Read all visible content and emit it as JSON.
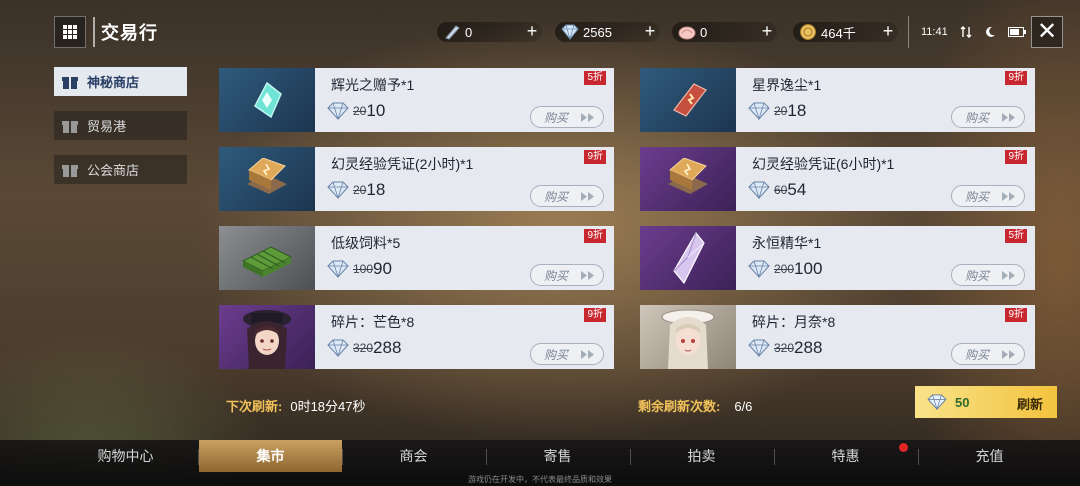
{
  "header": {
    "title": "交易行",
    "menu_icon": "grid-menu-icon",
    "currencies": [
      {
        "icon": "crystal-pen-icon",
        "value": "0"
      },
      {
        "icon": "diamond-icon",
        "value": "2565"
      },
      {
        "icon": "shell-icon",
        "value": "0"
      },
      {
        "icon": "gold-coin-icon",
        "value": "464千"
      }
    ],
    "time": "11:41"
  },
  "sidebar": {
    "items": [
      {
        "label": "神秘商店",
        "active": true
      },
      {
        "label": "贸易港",
        "active": false
      },
      {
        "label": "公会商店",
        "active": false
      }
    ]
  },
  "shop": {
    "buy_label": "购买",
    "items": [
      {
        "name": "辉光之赠予*1",
        "old_price": "20",
        "price": "10",
        "discount": "5折",
        "thumb": "glow-gift-icon"
      },
      {
        "name": "星界逸尘*1",
        "old_price": "20",
        "price": "18",
        "discount": "9折",
        "thumb": "star-dust-book-icon"
      },
      {
        "name": "幻灵经验凭证(2小时)*1",
        "old_price": "20",
        "price": "18",
        "discount": "9折",
        "thumb": "exp-book-icon"
      },
      {
        "name": "幻灵经验凭证(6小时)*1",
        "old_price": "60",
        "price": "54",
        "discount": "9折",
        "thumb": "exp-book-icon"
      },
      {
        "name": "低级饲料*5",
        "old_price": "100",
        "price": "90",
        "discount": "9折",
        "thumb": "feed-bundle-icon"
      },
      {
        "name": "永恒精华*1",
        "old_price": "200",
        "price": "100",
        "discount": "5折",
        "thumb": "eternal-crystal-icon"
      },
      {
        "name": "碎片：芒色*8",
        "old_price": "320",
        "price": "288",
        "discount": "9折",
        "thumb": "character-portrait-mangse"
      },
      {
        "name": "碎片：月奈*8",
        "old_price": "320",
        "price": "288",
        "discount": "9折",
        "thumb": "character-portrait-yuenai"
      }
    ]
  },
  "info": {
    "next_refresh_label": "下次刷新:",
    "next_refresh_value": "0时18分47秒",
    "remaining_label": "剩余刷新次数:",
    "remaining_value": "6/6"
  },
  "refresh": {
    "cost": "50",
    "label": "刷新"
  },
  "bottom_nav": {
    "tabs": [
      {
        "label": "购物中心",
        "active": false
      },
      {
        "label": "集市",
        "active": true
      },
      {
        "label": "商会",
        "active": false
      },
      {
        "label": "寄售",
        "active": false
      },
      {
        "label": "拍卖",
        "active": false
      },
      {
        "label": "特惠",
        "active": false
      },
      {
        "label": "充值",
        "active": false
      }
    ]
  },
  "footnote": "游戏仍在开发中，不代表最终品质和效果",
  "colors": {
    "accent_gold": "#f2c25a",
    "discount_red": "#c9272f",
    "card_bg": "#e6e9ef",
    "sidebar_active_text": "#2a3f66"
  }
}
